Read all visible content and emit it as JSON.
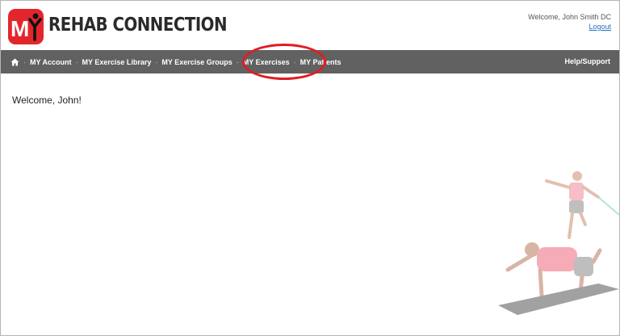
{
  "app": {
    "logo_text": "MY",
    "brand": "REHAB CONNECTION"
  },
  "user": {
    "greeting": "Welcome, John Smith DC",
    "logout_label": "Logout"
  },
  "nav": {
    "home_icon": "home-icon",
    "items": [
      {
        "label": "MY Account"
      },
      {
        "label": "MY Exercise Library"
      },
      {
        "label": "MY Exercise Groups"
      },
      {
        "label": "MY Exercises"
      },
      {
        "label": "MY Patients"
      }
    ],
    "help_label": "Help/Support"
  },
  "main": {
    "welcome": "Welcome, John!"
  },
  "colors": {
    "brand_red": "#e3262c",
    "navbar": "#616161",
    "highlight": "#e01d24",
    "link": "#2a6fbf"
  }
}
